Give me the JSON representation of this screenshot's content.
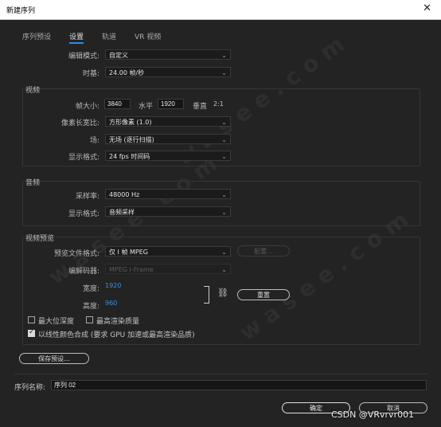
{
  "window": {
    "title": "新建序列"
  },
  "tabs": [
    {
      "label": "序列预设"
    },
    {
      "label": "设置"
    },
    {
      "label": "轨道"
    },
    {
      "label": "VR 视频"
    }
  ],
  "settings": {
    "editing_mode_label": "编辑模式:",
    "editing_mode_value": "自定义",
    "timebase_label": "时基:",
    "timebase_value": "24.00  帧/秒"
  },
  "video": {
    "title": "视频",
    "frame_size_label": "帧大小:",
    "frame_width": "3840",
    "horizontal_label": "水平",
    "frame_height": "1920",
    "vertical_label": "垂直",
    "aspect": "2:1",
    "pixel_aspect_label": "像素长宽比:",
    "pixel_aspect_value": "方形像素 (1.0)",
    "fields_label": "场:",
    "fields_value": "无场 (逐行扫描)",
    "display_format_label": "显示格式:",
    "display_format_value": "24 fps 时间码"
  },
  "audio": {
    "title": "音频",
    "sample_rate_label": "采样率:",
    "sample_rate_value": "48000 Hz",
    "display_format_label": "显示格式:",
    "display_format_value": "音频采样"
  },
  "preview": {
    "title": "视频预览",
    "file_format_label": "预览文件格式:",
    "file_format_value": "仅 I 帧 MPEG",
    "configure_label": "配置...",
    "codec_label": "编解码器:",
    "codec_value": "MPEG I-Frame",
    "width_label": "宽度:",
    "width_value": "1920",
    "height_label": "高度:",
    "height_value": "960",
    "reset_label": "重置",
    "max_bit_depth_label": "最大位深度",
    "max_render_quality_label": "最高渲染质量",
    "linear_color_label": "以线性颜色合成 (要求 GPU 加速或最高渲染品质)"
  },
  "footer": {
    "save_preset_label": "保存预设...",
    "sequence_name_label": "序列名称:",
    "sequence_name_value": "序列 02",
    "ok_label": "确定",
    "cancel_label": "取消"
  },
  "watermark_text": "CSDN @VRvrvr001",
  "checkbox_state": {
    "max_bit_depth": false,
    "max_render_quality": false,
    "linear_color": true
  },
  "colors": {
    "accent": "#2d8ceb",
    "link_blue": "#3e8fe0",
    "background": "#232323"
  }
}
